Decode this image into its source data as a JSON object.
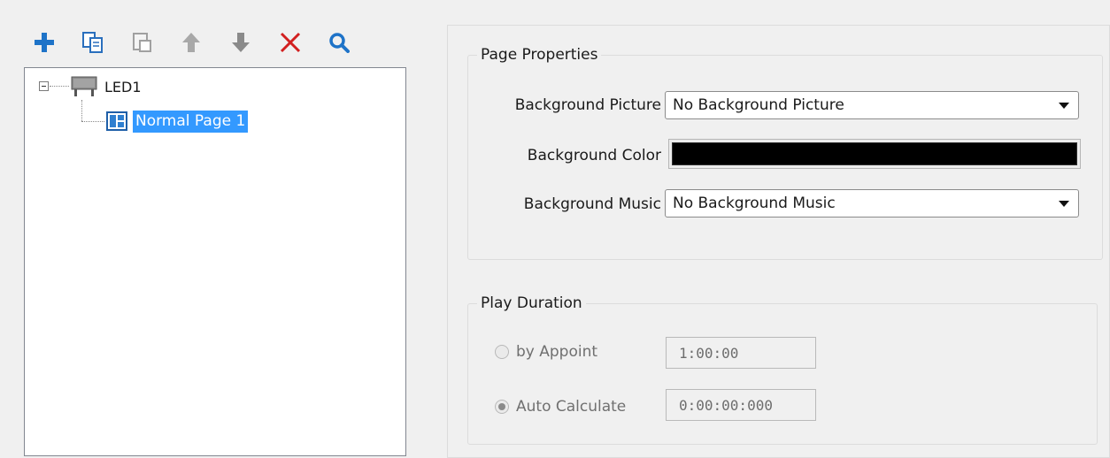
{
  "toolbar": {
    "buttons": [
      {
        "icon": "plus-icon",
        "color": "#1e73c8",
        "enabled": true
      },
      {
        "icon": "copy-icon",
        "color": "#2a6fbd",
        "enabled": true
      },
      {
        "icon": "paste-icon",
        "color": "#9a9a9a",
        "enabled": false
      },
      {
        "icon": "arrow-up-icon",
        "color": "#a8a8a8",
        "enabled": false
      },
      {
        "icon": "arrow-down-icon",
        "color": "#8a8a8a",
        "enabled": true
      },
      {
        "icon": "delete-icon",
        "color": "#d21f1f",
        "enabled": true
      },
      {
        "icon": "search-icon",
        "color": "#1e73c8",
        "enabled": true
      }
    ]
  },
  "tree": {
    "root": {
      "label": "LED1",
      "icon": "led-screen-icon",
      "expanded": true
    },
    "child": {
      "label": "Normal Page 1",
      "icon": "page-layout-icon",
      "selected": true,
      "selection_color": "#3399ff"
    }
  },
  "page_properties": {
    "title": "Page Properties",
    "background_picture": {
      "label": "Background Picture",
      "value": "No Background Picture"
    },
    "background_color": {
      "label": "Background Color",
      "value": "#000000"
    },
    "background_music": {
      "label": "Background Music",
      "value": "No Background Music"
    }
  },
  "play_duration": {
    "title": "Play Duration",
    "by_appoint": {
      "label": "by Appoint",
      "value": "1:00:00",
      "checked": false
    },
    "auto_calculate": {
      "label": "Auto Calculate",
      "value": "0:00:00:000",
      "checked": true
    }
  }
}
